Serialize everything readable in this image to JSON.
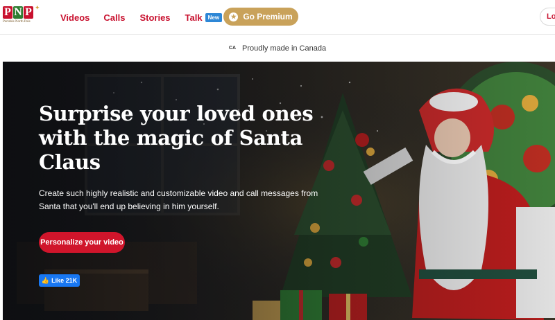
{
  "logo": {
    "letters": [
      "P",
      "N",
      "P"
    ],
    "letter_colors": [
      "#c8102e",
      "#2e7d32",
      "#c8102e"
    ],
    "subtitle": "Portable North Pole"
  },
  "nav": {
    "items": [
      {
        "label": "Videos"
      },
      {
        "label": "Calls"
      },
      {
        "label": "Stories"
      },
      {
        "label": "Talk",
        "badge": "New"
      }
    ]
  },
  "premium": {
    "label": "Go Premium",
    "icon": "star-icon"
  },
  "login": {
    "label": "Log"
  },
  "canada": {
    "flag": "CA",
    "text": "Proudly made in Canada"
  },
  "hero": {
    "title": "Surprise your loved ones with the magic of Santa Claus",
    "subtitle": "Create such highly realistic and customizable video and call messages from Santa that you'll end up believing in him yourself.",
    "cta": "Personalize your video",
    "like": "Like 21K"
  },
  "colors": {
    "brand_red": "#c8102e",
    "gold": "#c9a25a",
    "facebook_blue": "#1877f2",
    "badge_blue": "#2d87d6"
  }
}
